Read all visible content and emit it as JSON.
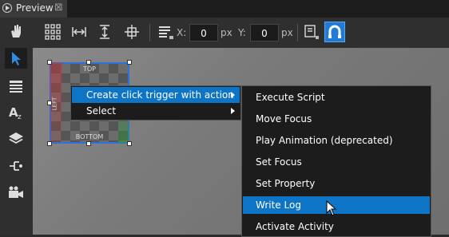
{
  "tab": {
    "title": "Preview",
    "close": "⊠"
  },
  "toolbar": {
    "x_label": "X:",
    "x_value": "0",
    "x_unit": "px",
    "y_label": "Y:",
    "y_value": "0",
    "y_unit": "px"
  },
  "node": {
    "top_label": "TOP",
    "bottom_label": "BOTTOM",
    "left_label": "LEFT"
  },
  "context_menu": {
    "items": [
      {
        "label": "Create click trigger with action",
        "highlighted": true,
        "has_submenu": true
      },
      {
        "label": "Select",
        "highlighted": false,
        "has_submenu": true
      }
    ]
  },
  "submenu": {
    "items": [
      {
        "label": "Execute Script"
      },
      {
        "label": "Move Focus"
      },
      {
        "label": "Play Animation (deprecated)"
      },
      {
        "label": "Set Focus"
      },
      {
        "label": "Set Property"
      },
      {
        "label": "Write Log",
        "highlighted": true
      },
      {
        "label": "Activate Activity"
      }
    ]
  },
  "colors": {
    "accent": "#0e75c6",
    "selection": "#2f6fe0"
  }
}
